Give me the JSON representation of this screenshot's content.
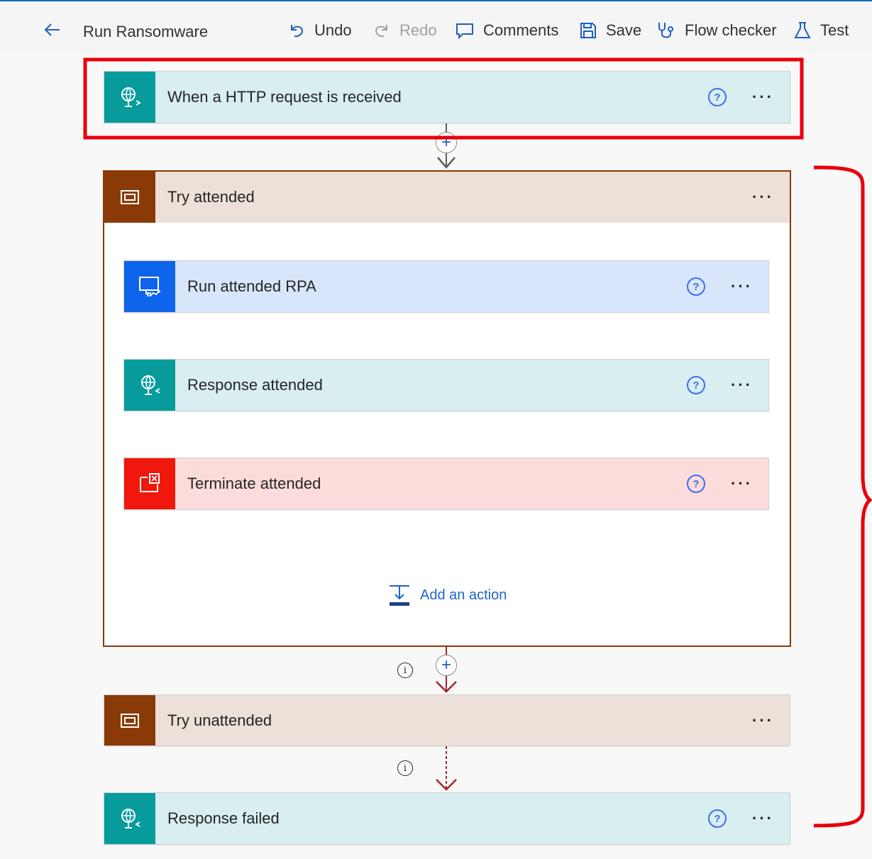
{
  "header": {
    "title": "Run Ransomware",
    "toolbar": {
      "undo": "Undo",
      "redo": "Redo",
      "comments": "Comments",
      "save": "Save",
      "flow_checker": "Flow checker",
      "test": "Test"
    }
  },
  "trigger": {
    "label": "When a HTTP request is received",
    "help": "?",
    "more": "···"
  },
  "scopes": {
    "try_attended": {
      "label": "Try attended",
      "more": "···",
      "actions": [
        {
          "label": "Run attended RPA",
          "help": "?",
          "more": "···"
        },
        {
          "label": "Response attended",
          "help": "?",
          "more": "···"
        },
        {
          "label": "Terminate attended",
          "help": "?",
          "more": "···"
        }
      ],
      "add_action": "Add an action"
    },
    "try_unattended": {
      "label": "Try unattended",
      "more": "···"
    }
  },
  "response_failed": {
    "label": "Response failed",
    "help": "?",
    "more": "···"
  },
  "connectors": {
    "plus": "+",
    "info": "i"
  },
  "colors": {
    "http": "#079b9c",
    "rpa": "#0f64ec",
    "terminate": "#f0170c",
    "scope": "#8a3a06",
    "annotation": "#e8000b"
  }
}
